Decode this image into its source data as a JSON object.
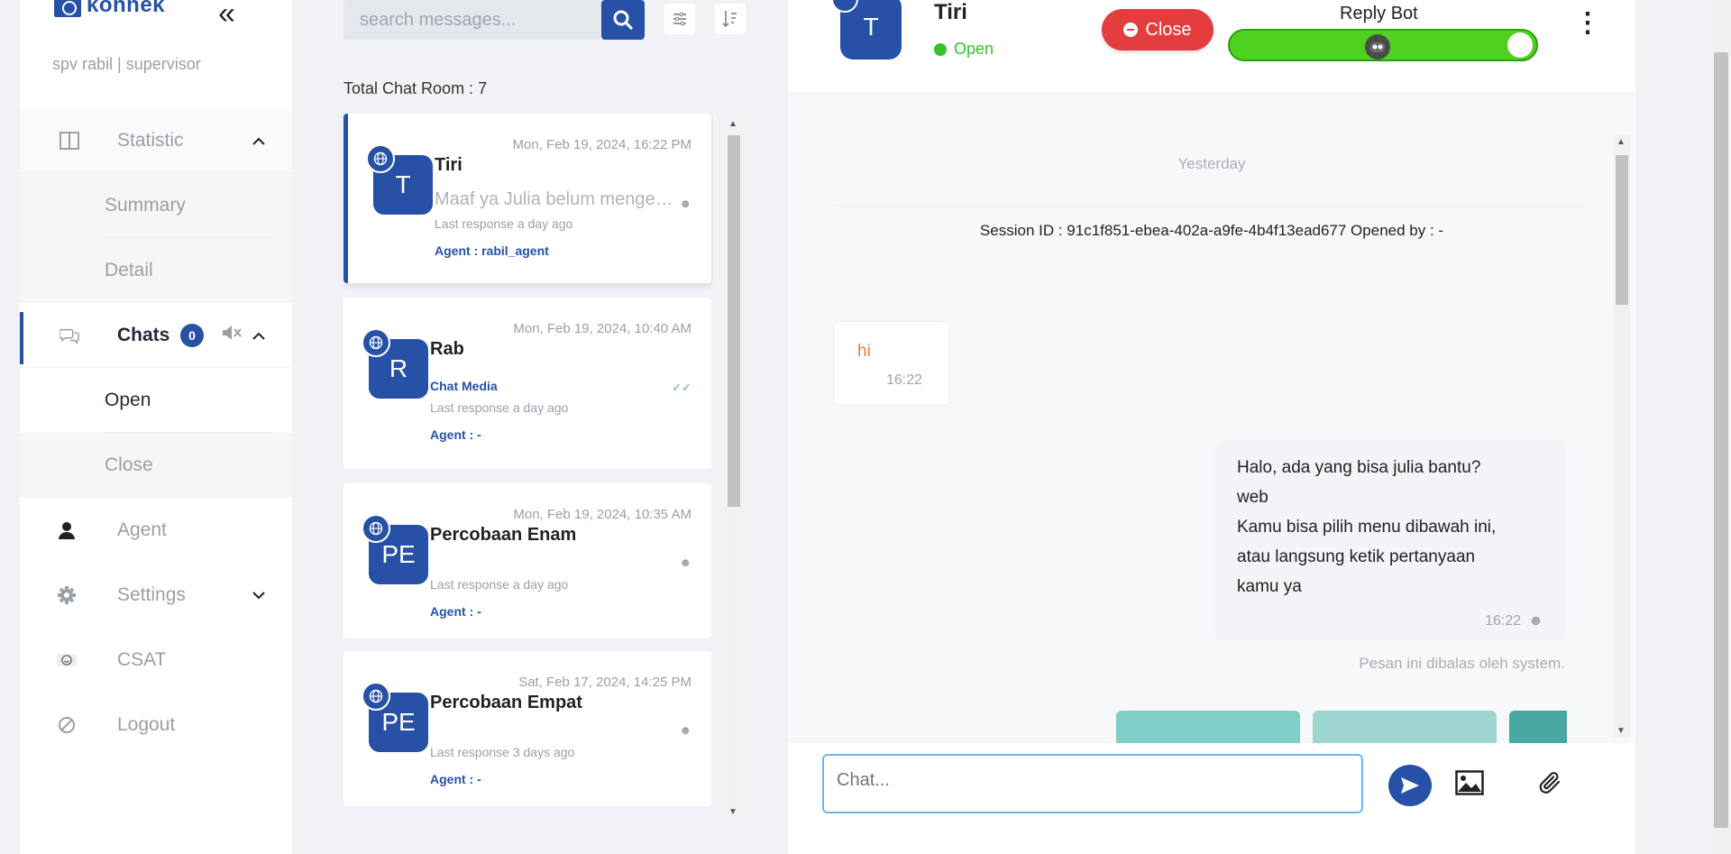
{
  "sidebar": {
    "logo_text": "konnek",
    "user_line": "spv rabil | supervisor",
    "statistic_label": "Statistic",
    "summary_label": "Summary",
    "detail_label": "Detail",
    "chats_label": "Chats",
    "chats_badge": "0",
    "open_label": "Open",
    "close_label": "Close",
    "agent_label": "Agent",
    "settings_label": "Settings",
    "csat_label": "CSAT",
    "logout_label": "Logout"
  },
  "chat_list": {
    "search_placeholder": "search messages...",
    "total_rooms": "Total Chat Room : 7",
    "rooms": [
      {
        "initials": "T",
        "name": "Tiri",
        "time": "Mon, Feb 19, 2024, 16:22 PM",
        "preview": "Maaf ya Julia belum mengerti maksud kamu",
        "last": "Last response a day ago",
        "agent": "Agent : rabil_agent"
      },
      {
        "initials": "R",
        "name": "Rab",
        "time": "Mon, Feb 19, 2024, 10:40 AM",
        "preview": "Chat Media",
        "last": "Last response a day ago",
        "agent": "Agent : -"
      },
      {
        "initials": "PE",
        "name": "Percobaan Enam",
        "time": "Mon, Feb 19, 2024, 10:35 AM",
        "preview": "",
        "last": "Last response a day ago",
        "agent": "Agent : -"
      },
      {
        "initials": "PE",
        "name": "Percobaan Empat",
        "time": "Sat, Feb 17, 2024, 14:25 PM",
        "preview": "",
        "last": "Last response 3 days ago",
        "agent": "Agent : -"
      }
    ]
  },
  "conversation": {
    "initials": "T",
    "name": "Tiri",
    "status": "Open",
    "close_label": "Close",
    "bot_label": "Reply Bot",
    "date_separator": "Yesterday",
    "session": "Session ID : 91c1f851-ebea-402a-a9fe-4b4f13ead677 Opened by : -",
    "incoming_text": "hi",
    "incoming_time": "16:22",
    "outgoing_lines": [
      "Halo, ada yang bisa julia bantu?",
      "web",
      "Kamu bisa pilih menu dibawah ini,",
      "atau langsung ketik pertanyaan",
      "kamu ya"
    ],
    "outgoing_time": "16:22",
    "system_note": "Pesan ini dibalas oleh system.",
    "input_placeholder": "Chat..."
  },
  "colors": {
    "brand": "#2651a6",
    "open_green": "#35c22a",
    "close_red": "#e43d3d",
    "toggle_green": "#4fd11f"
  }
}
